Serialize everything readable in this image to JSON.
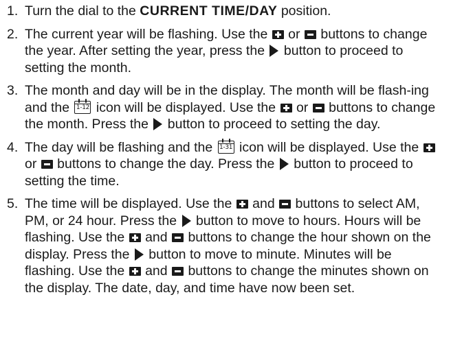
{
  "steps": [
    {
      "number": "1.",
      "parts": {
        "a": "Turn the dial to the ",
        "b": "CURRENT TIME/DAY",
        "c": " position."
      }
    },
    {
      "number": "2.",
      "parts": {
        "a": "The current year will be flashing. Use the ",
        "b": " or ",
        "c": " buttons to change the year. After setting the year, press the ",
        "d": " button to proceed to setting the month."
      }
    },
    {
      "number": "3.",
      "parts": {
        "a": "The month and day will be in the display. The month will be flash-ing and the ",
        "b": " icon will be displayed. Use the ",
        "c": " or ",
        "d": " buttons to change the month. Press the ",
        "e": " button to proceed to setting the day."
      },
      "calendar_icon_text": "1-12"
    },
    {
      "number": "4.",
      "parts": {
        "a": "The day will be flashing and the ",
        "b": " icon will be displayed. Use the ",
        "c": " or ",
        "d": " buttons to change the day. Press the ",
        "e": " button to proceed to setting the time."
      },
      "calendar_icon_text": "1-31"
    },
    {
      "number": "5.",
      "parts": {
        "a": "The time will be displayed. Use the ",
        "b": " and ",
        "c": " buttons to select AM, PM, or 24 hour. Press the ",
        "d": " button to move to hours. Hours will be flashing. Use the ",
        "e": " and ",
        "f": " buttons to change the hour shown on the display. Press the ",
        "g": " button to move to minute. Minutes will be flashing. Use the ",
        "h": " and ",
        "i": " buttons to change the minutes shown on the display. The date, day, and time have now been set."
      }
    }
  ],
  "icons": {
    "plus": "plus-button-icon",
    "minus": "minus-button-icon",
    "arrow": "right-arrow-button-icon",
    "calendar": "calendar-icon"
  },
  "colors": {
    "text": "#1a1a1a",
    "background": "#ffffff"
  }
}
